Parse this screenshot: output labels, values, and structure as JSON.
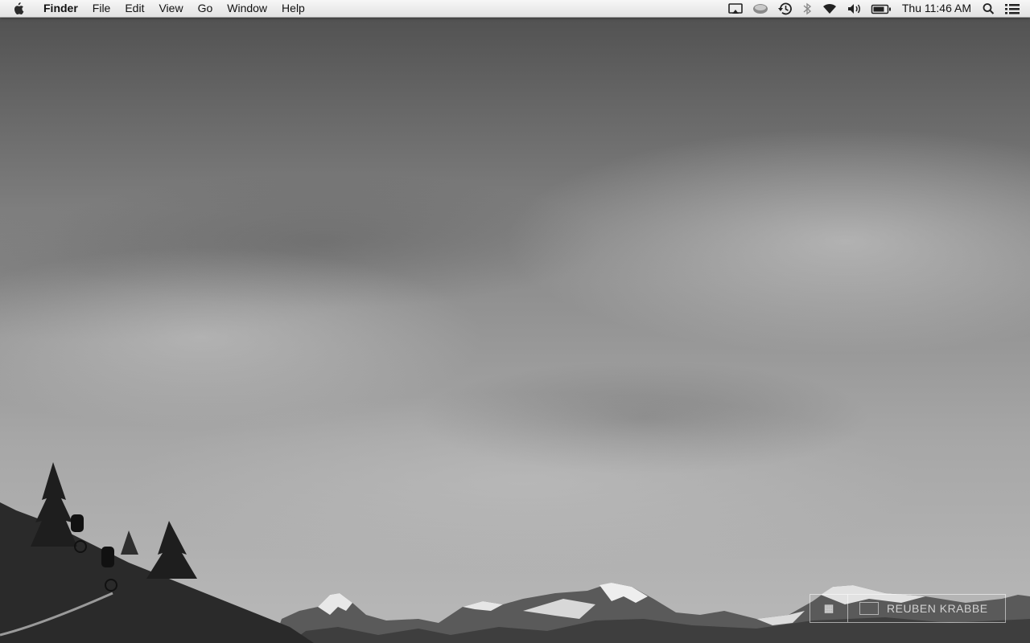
{
  "menubar": {
    "apple_icon": "apple-logo-icon",
    "app_name": "Finder",
    "menus": [
      "File",
      "Edit",
      "View",
      "Go",
      "Window",
      "Help"
    ],
    "status_icons": [
      "airplay-icon",
      "disk-icon",
      "time-machine-icon",
      "bluetooth-icon",
      "wifi-icon",
      "volume-icon",
      "battery-icon"
    ],
    "clock": "Thu 11:46 AM",
    "spotlight_icon": "spotlight-search-icon",
    "notification_icon": "notification-center-icon"
  },
  "wallpaper": {
    "watermark_text": "REUBEN KRABBE"
  }
}
